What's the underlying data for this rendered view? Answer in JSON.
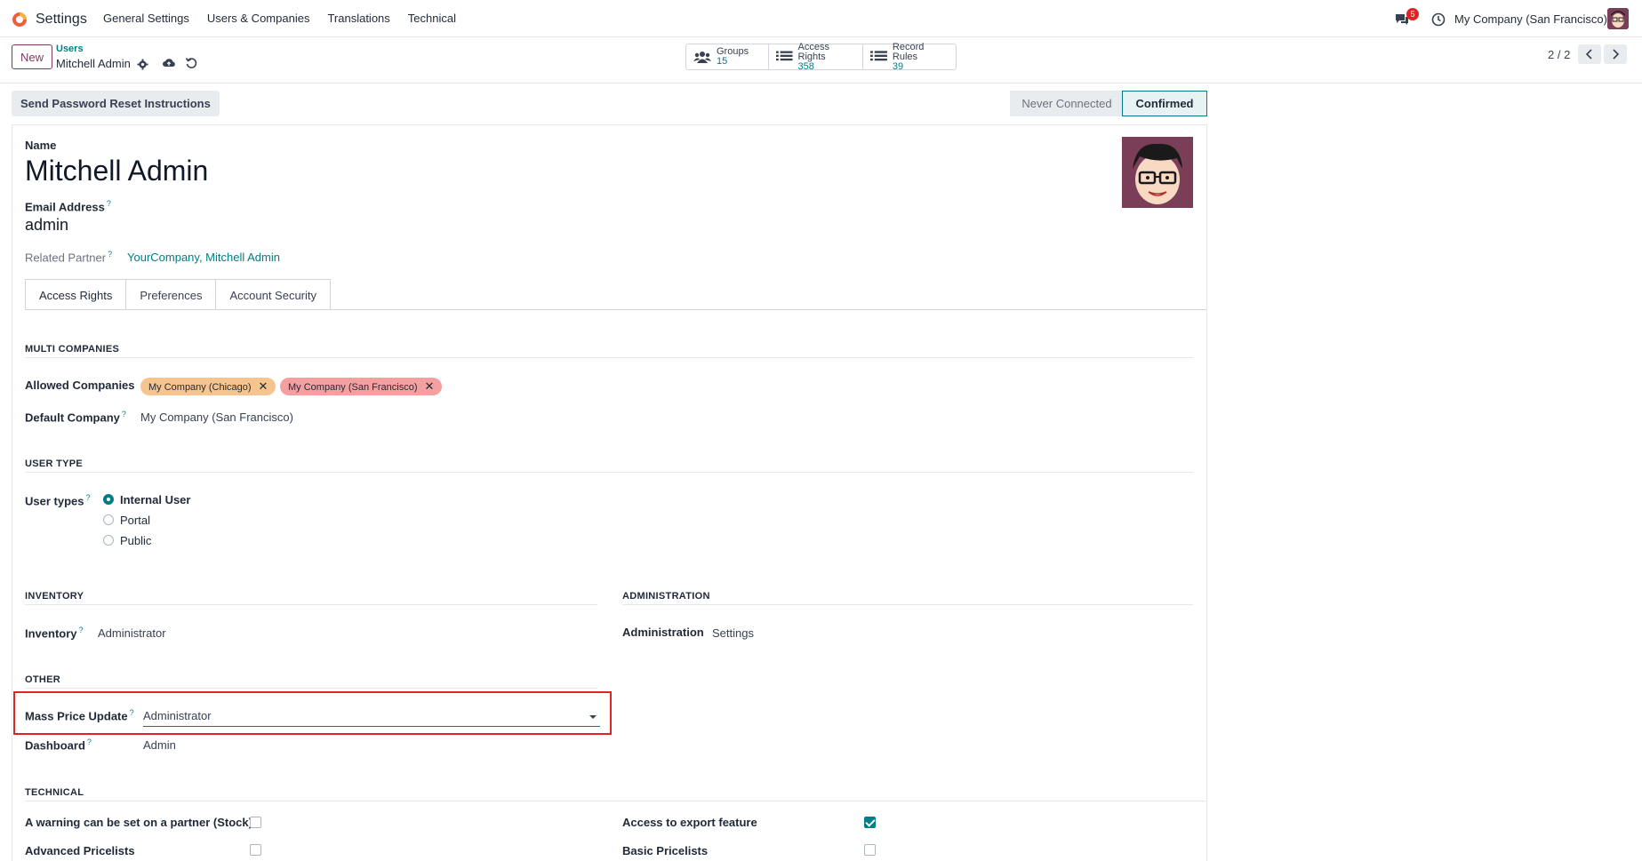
{
  "topnav": {
    "app_name": "Settings",
    "menu": [
      "General Settings",
      "Users & Companies",
      "Translations",
      "Technical"
    ],
    "chat_badge": "5",
    "company": "My Company (San Francisco)"
  },
  "control": {
    "new_label": "New",
    "breadcrumb_parent": "Users",
    "breadcrumb_current": "Mitchell Admin",
    "stats": [
      {
        "label": "Groups",
        "value": "15",
        "icon": "users-icon"
      },
      {
        "label": "Access Rights",
        "value": "358",
        "icon": "list-icon"
      },
      {
        "label": "Record Rules",
        "value": "39",
        "icon": "list-icon"
      }
    ],
    "pager": "2 / 2"
  },
  "status": {
    "reset_button": "Send Password Reset Instructions",
    "never_connected": "Never Connected",
    "confirmed": "Confirmed"
  },
  "form": {
    "name_label": "Name",
    "name": "Mitchell Admin",
    "email_label": "Email Address",
    "email": "admin",
    "related_partner_label": "Related Partner",
    "related_partner": "YourCompany, Mitchell Admin",
    "help_mark": "?"
  },
  "tabs": [
    "Access Rights",
    "Preferences",
    "Account Security"
  ],
  "access": {
    "multi_companies": "MULTI COMPANIES",
    "allowed_companies_label": "Allowed Companies",
    "allowed_companies": [
      {
        "name": "My Company (Chicago)",
        "color": "#f6c48f"
      },
      {
        "name": "My Company (San Francisco)",
        "color": "#f5a0a0"
      }
    ],
    "default_company_label": "Default Company",
    "default_company": "My Company (San Francisco)",
    "user_type_section": "USER TYPE",
    "user_types_label": "User types",
    "user_types": [
      {
        "label": "Internal User",
        "checked": true
      },
      {
        "label": "Portal",
        "checked": false
      },
      {
        "label": "Public",
        "checked": false
      }
    ],
    "inventory_section": "INVENTORY",
    "inventory_label": "Inventory",
    "inventory_value": "Administrator",
    "administration_section": "ADMINISTRATION",
    "administration_label": "Administration",
    "administration_value": "Settings",
    "other_section": "OTHER",
    "mass_price_label": "Mass Price Update",
    "mass_price_value": "Administrator",
    "dashboard_label": "Dashboard",
    "dashboard_value": "Admin",
    "technical_section": "TECHNICAL",
    "technical_left": [
      {
        "label": "A warning can be set on a partner (Stock)",
        "checked": false
      },
      {
        "label": "Advanced Pricelists",
        "checked": false
      }
    ],
    "technical_right": [
      {
        "label": "Access to export feature",
        "checked": true
      },
      {
        "label": "Basic Pricelists",
        "checked": false
      }
    ]
  }
}
